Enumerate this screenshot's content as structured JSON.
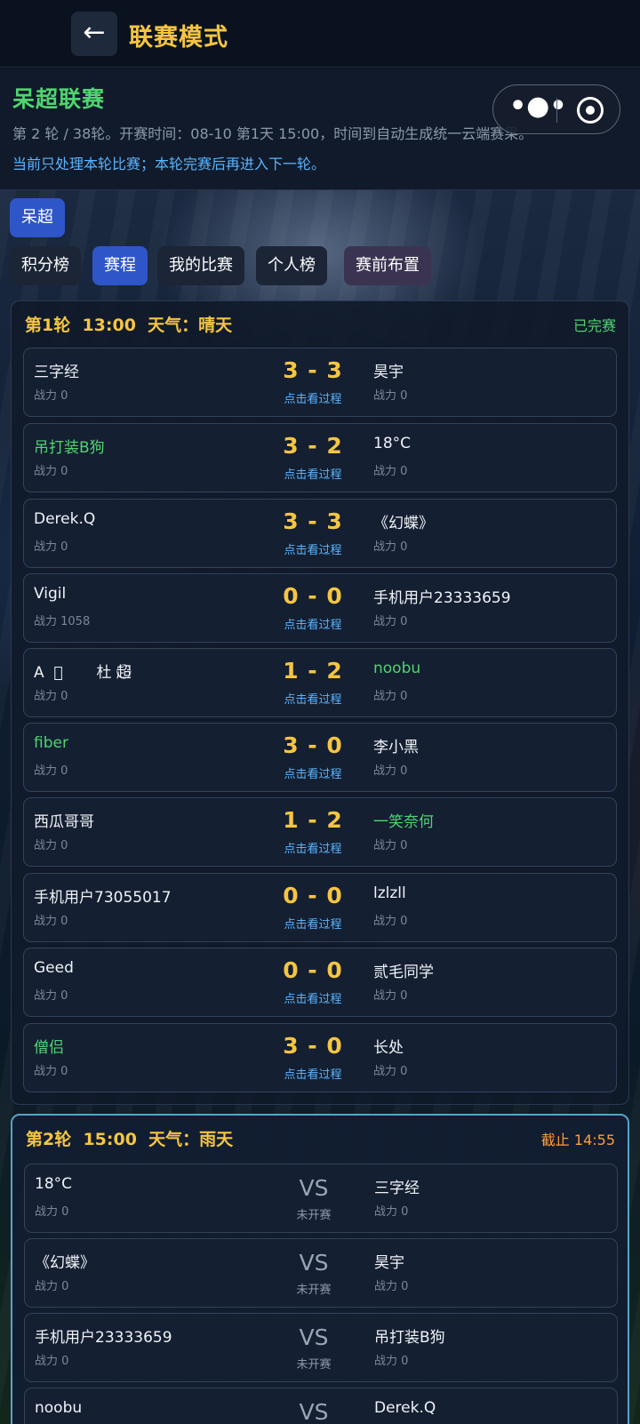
{
  "header": {
    "back_icon": "←",
    "title": "联赛模式"
  },
  "capsule": {
    "more_icon": "•●•"
  },
  "league": {
    "name": "呆超联赛",
    "desc": "第 2 轮 / 38轮。开赛时间：08-10 第1天 15:00，时间到自动生成统一云端赛果。",
    "note": "当前只处理本轮比赛；本轮完赛后再进入下一轮。"
  },
  "league_chip": "呆超",
  "tabs": [
    "积分榜",
    "赛程",
    "我的比赛",
    "个人榜",
    "赛前布置"
  ],
  "active_tab": "赛程",
  "colors": {
    "accent": "#f5c542",
    "green": "#4fd46f",
    "link": "#5ab4ff",
    "active_tab": "#2e56c9"
  },
  "rounds": [
    {
      "title": "第1轮  13:00  天气：晴天",
      "status": "已完赛",
      "matches": [
        {
          "home": "三字经",
          "home_power": "战力 0",
          "score": "3 - 3",
          "away": "昊宇",
          "away_power": "战力 0",
          "link": "点击看过程"
        },
        {
          "home": "吊打装B狗",
          "home_power": "战力 0",
          "score": "3 - 2",
          "away": "18°C",
          "away_power": "战力 0",
          "link": "点击看过程"
        },
        {
          "home": "Derek.Q",
          "home_power": "战力 0",
          "score": "3 - 3",
          "away": "《幻蝶》",
          "away_power": "战力 0",
          "link": "点击看过程"
        },
        {
          "home": "Vigil",
          "home_power": "战力 1058",
          "score": "0 - 0",
          "away": "手机用户23333659",
          "away_power": "战力 0",
          "link": "点击看过程"
        },
        {
          "home": "A  ⃝       杜 超⃝",
          "home_power": "战力 0",
          "score": "1 - 2",
          "away": "noobu",
          "away_power": "战力 0",
          "link": "点击看过程"
        },
        {
          "home": "fiber",
          "home_power": "战力 0",
          "score": "3 - 0",
          "away": "李小黑",
          "away_power": "战力 0",
          "link": "点击看过程"
        },
        {
          "home": "西瓜哥哥",
          "home_power": "战力 0",
          "score": "1 - 2",
          "away": "一笑奈何",
          "away_power": "战力 0",
          "link": "点击看过程"
        },
        {
          "home": "手机用户73055017",
          "home_power": "战力 0",
          "score": "0 - 0",
          "away": "lzlzll",
          "away_power": "战力 0",
          "link": "点击看过程"
        },
        {
          "home": "Geed",
          "home_power": "战力 0",
          "score": "0 - 0",
          "away": "贰毛同学",
          "away_power": "战力 0",
          "link": "点击看过程"
        },
        {
          "home": "僧侣",
          "home_power": "战力 0",
          "score": "3 - 0",
          "away": "长处",
          "away_power": "战力 0",
          "link": "点击看过程"
        }
      ]
    },
    {
      "title": "第2轮  15:00  天气：雨天",
      "status": "截止 14:55",
      "matches": [
        {
          "home": "18°C",
          "home_power": "战力 0",
          "vs": "VS",
          "away": "三字经",
          "away_power": "战力 0",
          "state": "未开赛"
        },
        {
          "home": "《幻蝶》",
          "home_power": "战力 0",
          "vs": "VS",
          "away": "昊宇",
          "away_power": "战力 0",
          "state": "未开赛"
        },
        {
          "home": "手机用户23333659",
          "home_power": "战力 0",
          "vs": "VS",
          "away": "吊打装B狗",
          "away_power": "战力 0",
          "state": "未开赛"
        },
        {
          "home": "noobu",
          "home_power": "",
          "vs": "VS",
          "away": "Derek.Q",
          "away_power": "",
          "state": ""
        }
      ]
    }
  ]
}
